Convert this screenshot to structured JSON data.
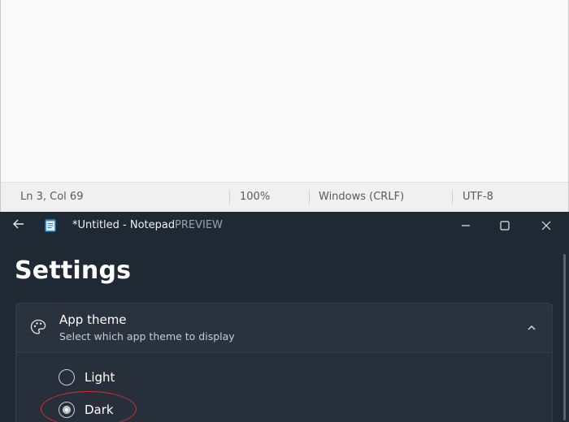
{
  "notepad_top": {
    "status": {
      "position": "Ln 3, Col 69",
      "zoom": "100%",
      "line_ending": "Windows (CRLF)",
      "encoding": "UTF-8"
    }
  },
  "notepad_dark": {
    "window": {
      "title": "*Untitled - Notepad",
      "badge": "PREVIEW"
    },
    "settings": {
      "heading": "Settings",
      "app_theme": {
        "title": "App theme",
        "description": "Select which app theme to display",
        "options": [
          {
            "label": "Light",
            "selected": false
          },
          {
            "label": "Dark",
            "selected": true
          }
        ]
      }
    }
  },
  "colors": {
    "dark_bg": "#1f2933",
    "card_bg": "#2a333d",
    "highlight": "#d0312d"
  }
}
